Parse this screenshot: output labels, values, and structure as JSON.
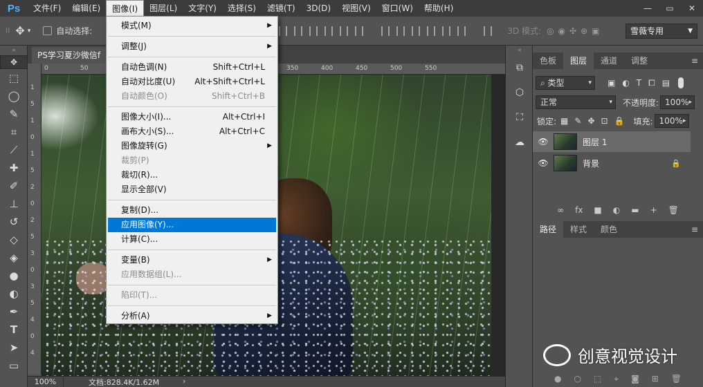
{
  "app": {
    "logo": "Ps"
  },
  "menubar": {
    "items": [
      "文件(F)",
      "编辑(E)",
      "图像(I)",
      "图层(L)",
      "文字(Y)",
      "选择(S)",
      "滤镜(T)",
      "3D(D)",
      "视图(V)",
      "窗口(W)",
      "帮助(H)"
    ],
    "active_index": 2
  },
  "window_buttons": {
    "minimize": "—",
    "restore": "▭",
    "close": "✕"
  },
  "options_bar": {
    "auto_select_label": "自动选择:",
    "mode_3d_label": "3D 模式:",
    "workspace": "雪薇专用"
  },
  "document": {
    "tab_title": "PS学习夏沙微信f",
    "zoom": "100%",
    "doc_info": "文档:828.4K/1.62M",
    "arrow": "›"
  },
  "ruler": {
    "top": [
      "0",
      "50",
      "350",
      "400",
      "450",
      "500",
      "550"
    ],
    "left": [
      "1",
      "5",
      "1",
      "0",
      "1",
      "5",
      "2",
      "0",
      "2",
      "5",
      "3",
      "0",
      "3",
      "5",
      "4",
      "0",
      "4"
    ]
  },
  "image_menu": {
    "items": [
      {
        "label": "模式(M)",
        "shortcut": "",
        "submenu": true,
        "disabled": false
      },
      {
        "sep": true
      },
      {
        "label": "调整(J)",
        "shortcut": "",
        "submenu": true,
        "disabled": false
      },
      {
        "sep": true
      },
      {
        "label": "自动色调(N)",
        "shortcut": "Shift+Ctrl+L",
        "submenu": false,
        "disabled": false
      },
      {
        "label": "自动对比度(U)",
        "shortcut": "Alt+Shift+Ctrl+L",
        "submenu": false,
        "disabled": false
      },
      {
        "label": "自动颜色(O)",
        "shortcut": "Shift+Ctrl+B",
        "submenu": false,
        "disabled": true
      },
      {
        "sep": true
      },
      {
        "label": "图像大小(I)...",
        "shortcut": "Alt+Ctrl+I",
        "submenu": false,
        "disabled": false
      },
      {
        "label": "画布大小(S)...",
        "shortcut": "Alt+Ctrl+C",
        "submenu": false,
        "disabled": false
      },
      {
        "label": "图像旋转(G)",
        "shortcut": "",
        "submenu": true,
        "disabled": false
      },
      {
        "label": "裁剪(P)",
        "shortcut": "",
        "submenu": false,
        "disabled": true
      },
      {
        "label": "裁切(R)...",
        "shortcut": "",
        "submenu": false,
        "disabled": false
      },
      {
        "label": "显示全部(V)",
        "shortcut": "",
        "submenu": false,
        "disabled": false
      },
      {
        "sep": true
      },
      {
        "label": "复制(D)...",
        "shortcut": "",
        "submenu": false,
        "disabled": false
      },
      {
        "label": "应用图像(Y)...",
        "shortcut": "",
        "submenu": false,
        "disabled": false,
        "highlighted": true
      },
      {
        "label": "计算(C)...",
        "shortcut": "",
        "submenu": false,
        "disabled": false
      },
      {
        "sep": true
      },
      {
        "label": "变量(B)",
        "shortcut": "",
        "submenu": true,
        "disabled": false
      },
      {
        "label": "应用数据组(L)...",
        "shortcut": "",
        "submenu": false,
        "disabled": true
      },
      {
        "sep": true
      },
      {
        "label": "陷印(T)...",
        "shortcut": "",
        "submenu": false,
        "disabled": true
      },
      {
        "sep": true
      },
      {
        "label": "分析(A)",
        "shortcut": "",
        "submenu": true,
        "disabled": false
      }
    ]
  },
  "panels": {
    "top_tabs": [
      "色板",
      "图层",
      "通道",
      "调整"
    ],
    "top_active": 1,
    "filter_kind": "类型",
    "blend_mode": "正常",
    "opacity_label": "不透明度:",
    "opacity_value": "100%",
    "lock_label": "锁定:",
    "fill_label": "填充:",
    "fill_value": "100%",
    "layers": [
      {
        "name": "图层 1",
        "selected": true,
        "locked": false
      },
      {
        "name": "背景",
        "selected": false,
        "locked": true
      }
    ],
    "bottom_tabs": [
      "路径",
      "样式",
      "颜色"
    ],
    "bottom_active": 0,
    "layer_actions": [
      "∞",
      "fx",
      "■",
      "◐",
      "▬",
      "+",
      "🗑"
    ]
  },
  "watermark": {
    "text": "创意视觉设计"
  }
}
